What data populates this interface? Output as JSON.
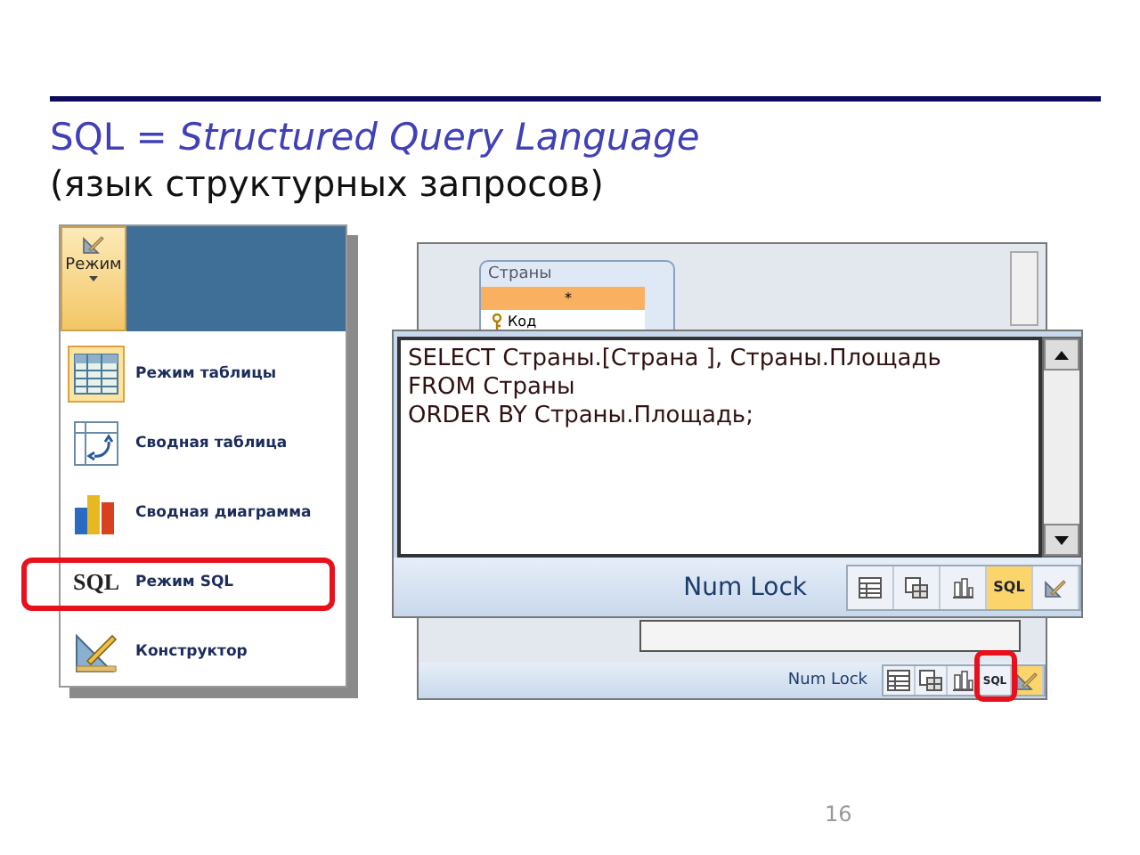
{
  "slide": {
    "title": "SQL = *Structured Query Language*",
    "subtitle": "(язык структурных запросов)",
    "page_number": "16"
  },
  "view_menu": {
    "button_label": "Режим",
    "items": [
      {
        "kind": "datasheet",
        "label": "Режим таблицы",
        "selected": true,
        "circled": false
      },
      {
        "kind": "pivot_table",
        "label": "Сводная таблица",
        "selected": false,
        "circled": false
      },
      {
        "kind": "pivot_chart",
        "label": "Сводная диаграмма",
        "selected": false,
        "circled": false
      },
      {
        "kind": "sql",
        "icon_text": "SQL",
        "label": "Режим SQL",
        "selected": false,
        "circled": true
      },
      {
        "kind": "design",
        "label": "Конструктор",
        "selected": false,
        "circled": false
      }
    ]
  },
  "query_design_window": {
    "table": {
      "title": "Страны",
      "fields": [
        {
          "name": "*",
          "selected": true,
          "key": false
        },
        {
          "name": "Код",
          "selected": false,
          "key": true
        }
      ]
    },
    "status_bar": {
      "text": "Num Lock",
      "views": [
        {
          "kind": "datasheet",
          "selected": false,
          "circled": false
        },
        {
          "kind": "pivot_table",
          "selected": false,
          "circled": false
        },
        {
          "kind": "pivot_chart",
          "selected": false,
          "circled": false
        },
        {
          "kind": "sql",
          "label": "SQL",
          "selected": false,
          "circled": true
        },
        {
          "kind": "design",
          "selected": true,
          "circled": false
        }
      ]
    }
  },
  "sql_window": {
    "lines": [
      "SELECT Страны.[Страна ], Страны.Площадь",
      "FROM Страны",
      "ORDER BY Страны.Площадь;"
    ],
    "status_bar": {
      "text": "Num Lock",
      "views": [
        {
          "kind": "datasheet",
          "selected": false,
          "circled": false
        },
        {
          "kind": "pivot_table",
          "selected": false,
          "circled": false
        },
        {
          "kind": "pivot_chart",
          "selected": false,
          "circled": false
        },
        {
          "kind": "sql",
          "label": "SQL",
          "selected": true,
          "circled": false
        },
        {
          "kind": "design",
          "selected": false,
          "circled": false
        }
      ]
    }
  }
}
